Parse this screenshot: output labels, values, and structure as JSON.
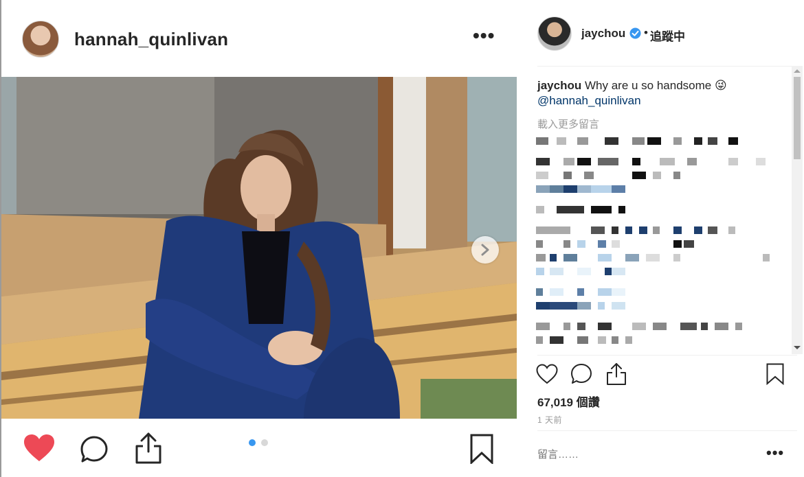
{
  "post_author": {
    "username": "hannah_quinlivan"
  },
  "header": {
    "more_label": "•••"
  },
  "carousel": {
    "count": 2,
    "active_index": 0,
    "accent": "#3897f0",
    "inactive": "#d8d8d8"
  },
  "actions": {
    "liked": true,
    "like_color": "#ed4956"
  },
  "sidebar": {
    "username": "jaychou",
    "verified": true,
    "separator": "•",
    "follow_label": "追蹤中"
  },
  "caption": {
    "username": "jaychou",
    "text": "Why are u so handsome 😜",
    "mention": "@hannah_quinlivan"
  },
  "comments": {
    "load_more_label": "載入更多留言"
  },
  "stats": {
    "likes": "67,019 個讚",
    "time_ago": "1 天前"
  },
  "comment_box": {
    "placeholder": "留言……",
    "more_label": "•••"
  }
}
